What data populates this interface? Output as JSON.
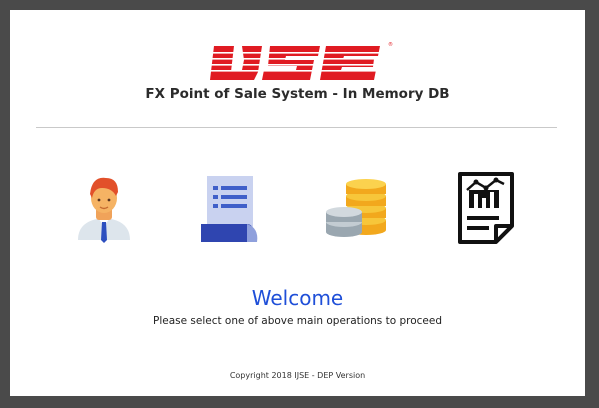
{
  "header": {
    "logo_text": "IJSE",
    "logo_mark": "®",
    "app_title": "FX Point of Sale System - In Memory DB"
  },
  "operations": [
    {
      "name": "customer-icon"
    },
    {
      "name": "order-document-icon"
    },
    {
      "name": "coins-icon"
    },
    {
      "name": "report-chart-icon"
    }
  ],
  "main": {
    "welcome": "Welcome",
    "instruction": "Please select one of above main operations to proceed"
  },
  "footer": {
    "copyright": "Copyright 2018 IJSE - DEP Version"
  },
  "colors": {
    "brand_red": "#e01b22",
    "welcome_blue": "#1f4fd8"
  }
}
